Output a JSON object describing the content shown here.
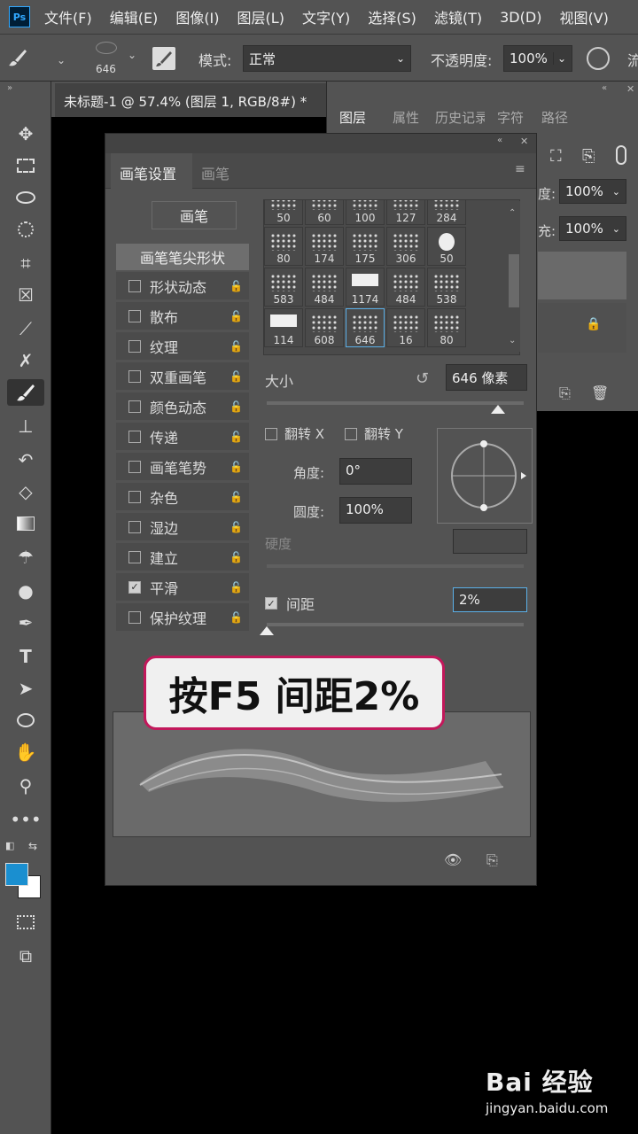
{
  "app": {
    "logo": "Ps"
  },
  "menu": [
    "文件(F)",
    "编辑(E)",
    "图像(I)",
    "图层(L)",
    "文字(Y)",
    "选择(S)",
    "滤镜(T)",
    "3D(D)",
    "视图(V)"
  ],
  "options": {
    "brush_size_label": "646",
    "mode_label": "模式:",
    "mode_value": "正常",
    "opacity_label": "不透明度:",
    "opacity_value": "100%",
    "extra_label": "流"
  },
  "document_tab": "未标题-1 @ 57.4% (图层 1, RGB/8#) *",
  "layers_panel": {
    "tabs": [
      "图层",
      "属性",
      "历史记录",
      "字符",
      "路径"
    ],
    "opacity_label": "度:",
    "opacity_value": "100%",
    "fill_label": "充:",
    "fill_value": "100%"
  },
  "brush_settings": {
    "tabs": [
      "画笔设置",
      "画笔"
    ],
    "presets_button": "画笔",
    "tip_shape": "画笔笔尖形状",
    "options": [
      {
        "label": "形状动态",
        "checked": false
      },
      {
        "label": "散布",
        "checked": false
      },
      {
        "label": "纹理",
        "checked": false
      },
      {
        "label": "双重画笔",
        "checked": false
      },
      {
        "label": "颜色动态",
        "checked": false
      },
      {
        "label": "传递",
        "checked": false
      },
      {
        "label": "画笔笔势",
        "checked": false
      },
      {
        "label": "杂色",
        "checked": false
      },
      {
        "label": "湿边",
        "checked": false
      },
      {
        "label": "建立",
        "checked": false
      },
      {
        "label": "平滑",
        "checked": true
      },
      {
        "label": "保护纹理",
        "checked": false
      }
    ],
    "brush_grid": [
      [
        "50",
        "60",
        "100",
        "127",
        "284"
      ],
      [
        "80",
        "174",
        "175",
        "306",
        "50"
      ],
      [
        "583",
        "484",
        "1174",
        "484",
        "538"
      ],
      [
        "114",
        "608",
        "646",
        "16",
        "80"
      ]
    ],
    "selected_brush": "646",
    "size_label": "大小",
    "size_value": "646 像素",
    "size_fraction": 0.9,
    "flip_x_label": "翻转 X",
    "flip_y_label": "翻转 Y",
    "angle_label": "角度:",
    "angle_value": "0°",
    "roundness_label": "圆度:",
    "roundness_value": "100%",
    "hardness_label": "硬度",
    "spacing_label": "间距",
    "spacing_checked": true,
    "spacing_value": "2%",
    "spacing_fraction": 0.0
  },
  "annotation": "按F5 间距2%",
  "watermark": {
    "brand": "Bai 经验",
    "url": "jingyan.baidu.com"
  },
  "colors": {
    "foreground": "#1a8fd0",
    "background": "#ffffff",
    "annotation_border": "#c2185b"
  }
}
